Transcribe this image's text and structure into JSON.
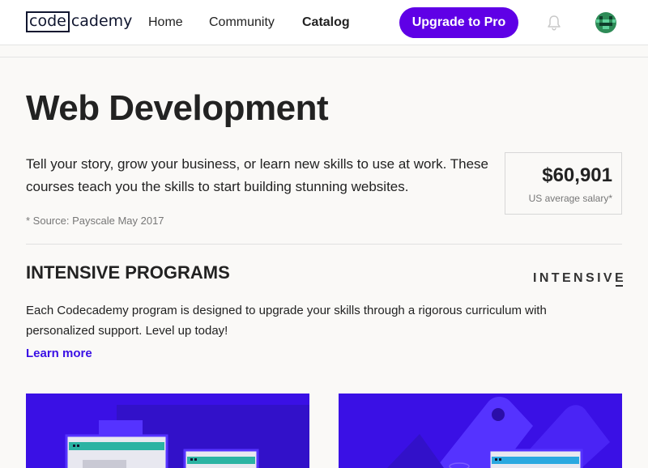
{
  "header": {
    "logo": {
      "code": "code",
      "cademy": "cademy"
    },
    "nav": [
      {
        "label": "Home"
      },
      {
        "label": "Community"
      },
      {
        "label": "Catalog"
      }
    ],
    "upgrade_label": "Upgrade to Pro",
    "bell_icon": "bell-icon",
    "avatar_icon": "user-avatar"
  },
  "main": {
    "title": "Web Development",
    "description": "Tell your story, grow your business, or learn new skills to use at work. These courses teach you the skills to start building stunning websites.",
    "source_note": "* Source: Payscale May 2017",
    "salary": {
      "value": "$60,901",
      "label": "US average salary*"
    }
  },
  "intensive": {
    "heading": "INTENSIVE PROGRAMS",
    "brand": "INTENSIVE",
    "description": "Each Codecademy program is designed to upgrade your skills through a rigorous curriculum with personalized support. Level up today!",
    "link_label": "Learn more"
  },
  "colors": {
    "accent": "#5f00e6",
    "link": "#3a10e5",
    "card_bg": "#3a10e5"
  }
}
